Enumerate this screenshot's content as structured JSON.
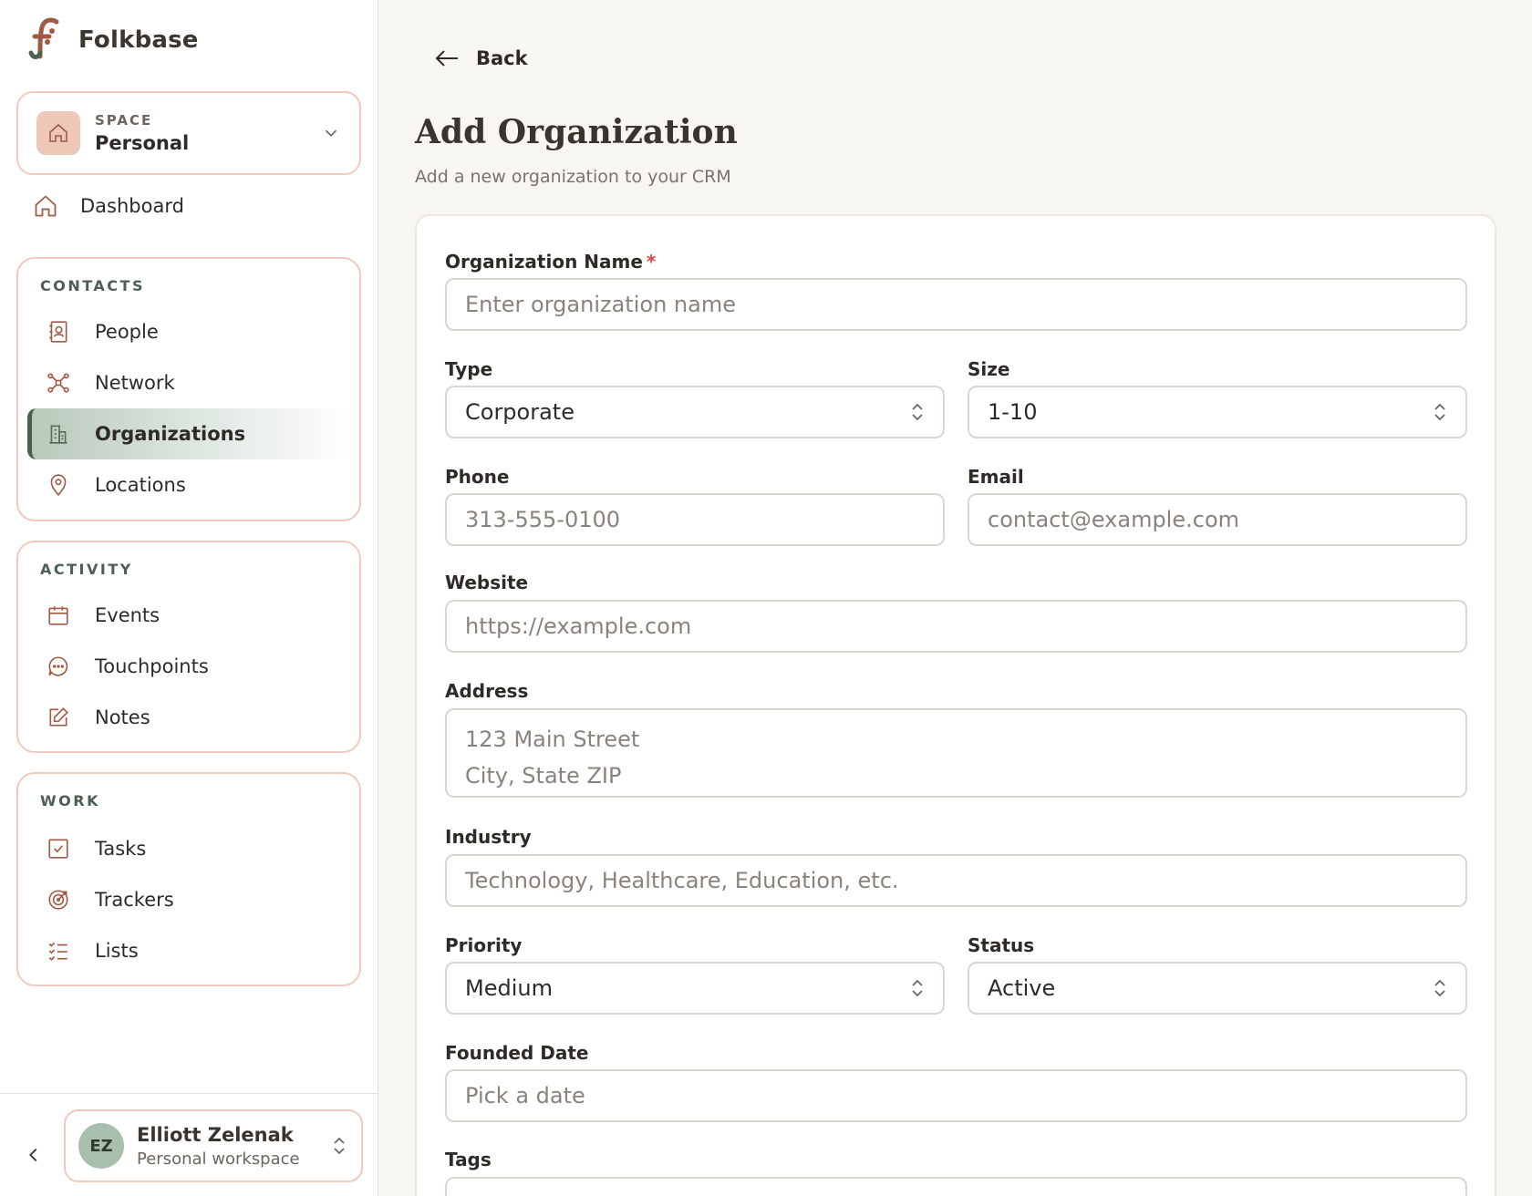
{
  "brand": {
    "name": "Folkbase"
  },
  "space": {
    "label": "SPACE",
    "name": "Personal"
  },
  "nav": {
    "dashboard": "Dashboard",
    "groups": [
      {
        "title": "CONTACTS",
        "items": [
          "People",
          "Network",
          "Organizations",
          "Locations"
        ]
      },
      {
        "title": "ACTIVITY",
        "items": [
          "Events",
          "Touchpoints",
          "Notes"
        ]
      },
      {
        "title": "WORK",
        "items": [
          "Tasks",
          "Trackers",
          "Lists"
        ]
      }
    ],
    "active": "Organizations"
  },
  "user": {
    "initials": "EZ",
    "name": "Elliott Zelenak",
    "workspace": "Personal workspace"
  },
  "main": {
    "back_label": "Back",
    "title": "Add Organization",
    "subtitle": "Add a new organization to your CRM"
  },
  "form": {
    "org_name": {
      "label": "Organization Name",
      "required_mark": "*",
      "placeholder": "Enter organization name"
    },
    "type": {
      "label": "Type",
      "value": "Corporate"
    },
    "size": {
      "label": "Size",
      "value": "1-10"
    },
    "phone": {
      "label": "Phone",
      "placeholder": "313-555-0100"
    },
    "email": {
      "label": "Email",
      "placeholder": "contact@example.com"
    },
    "website": {
      "label": "Website",
      "placeholder": "https://example.com"
    },
    "address": {
      "label": "Address",
      "placeholder": "123 Main Street\nCity, State ZIP"
    },
    "industry": {
      "label": "Industry",
      "placeholder": "Technology, Healthcare, Education, etc."
    },
    "priority": {
      "label": "Priority",
      "value": "Medium"
    },
    "status": {
      "label": "Status",
      "value": "Active"
    },
    "founded": {
      "label": "Founded Date",
      "placeholder": "Pick a date"
    },
    "tags": {
      "label": "Tags"
    }
  },
  "colors": {
    "accent": "#4b6050",
    "brand_pink": "#f1c9bd",
    "icon_brown": "#a05a44"
  }
}
